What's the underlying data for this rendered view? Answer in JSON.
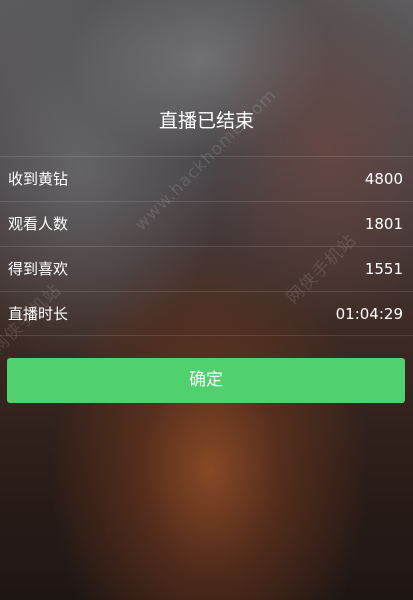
{
  "dialog": {
    "title": "直播已结束",
    "stats": [
      {
        "label": "收到黄钻",
        "value": "4800"
      },
      {
        "label": "观看人数",
        "value": "1801"
      },
      {
        "label": "得到喜欢",
        "value": "1551"
      },
      {
        "label": "直播时长",
        "value": "01:04:29"
      }
    ],
    "confirm_label": "确定"
  },
  "watermarks": {
    "url": "www.hackhome.com",
    "site_right": "网侠手机站",
    "site_left": "网侠手机站"
  },
  "colors": {
    "confirm_button": "#4fd16d",
    "text": "#ffffff"
  }
}
